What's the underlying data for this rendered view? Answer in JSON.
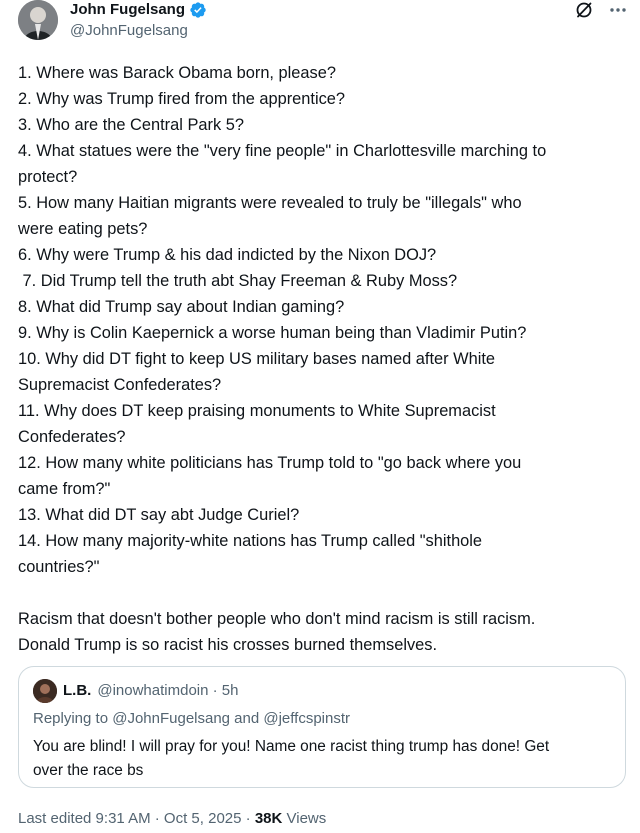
{
  "author": {
    "display_name": "John Fugelsang",
    "handle": "@JohnFugelsang",
    "verified": true
  },
  "icons": {
    "verified": "verified-badge-icon",
    "grok": "grok-icon",
    "more": "more-dots-icon"
  },
  "colors": {
    "verified_blue": "#1d9bf0",
    "text_primary": "#0f1419",
    "text_secondary": "#536471",
    "border": "#cfd9de"
  },
  "tweet": {
    "lines": [
      "1. Where was Barack Obama born, please?",
      "2. Why was Trump fired from the apprentice?",
      "3. Who are the Central Park 5?",
      "4. What statues were the \"very fine people\" in Charlottesville marching to",
      "protect?",
      "5. How many Haitian migrants were revealed to truly be \"illegals\" who",
      "were eating pets?",
      "6. Why were Trump & his dad indicted by the Nixon DOJ?",
      " 7. Did Trump tell the truth abt Shay Freeman & Ruby Moss?",
      "8. What did Trump say about Indian gaming?",
      "9. Why is Colin Kaepernick a worse human being than Vladimir Putin?",
      "10. Why did DT fight to keep US military bases named after White",
      "Supremacist Confederates?",
      "11. Why does DT keep praising monuments to White Supremacist",
      "Confederates?",
      "12. How many white politicians has Trump told to \"go back where you",
      "came from?\"",
      "13. What did DT say abt Judge Curiel?",
      "14. How many majority-white nations has Trump called \"shithole",
      "countries?\""
    ],
    "closing_lines": [
      "Racism that doesn't bother people who don't mind racism is still racism.",
      "Donald Trump is so racist his crosses burned themselves."
    ]
  },
  "quoted": {
    "display_name": "L.B.",
    "meta": "@inowhatimdoin · 5h",
    "replying_to": "Replying to @JohnFugelsang and @jeffcspinstr",
    "lines": [
      "You are blind! I will pray for you! Name one racist thing trump has done! Get",
      "over the race bs"
    ]
  },
  "footer": {
    "edited": "Last edited 9:31 AM · Oct 5, 2025 · ",
    "views_count": "38K",
    "views_label": " Views"
  }
}
